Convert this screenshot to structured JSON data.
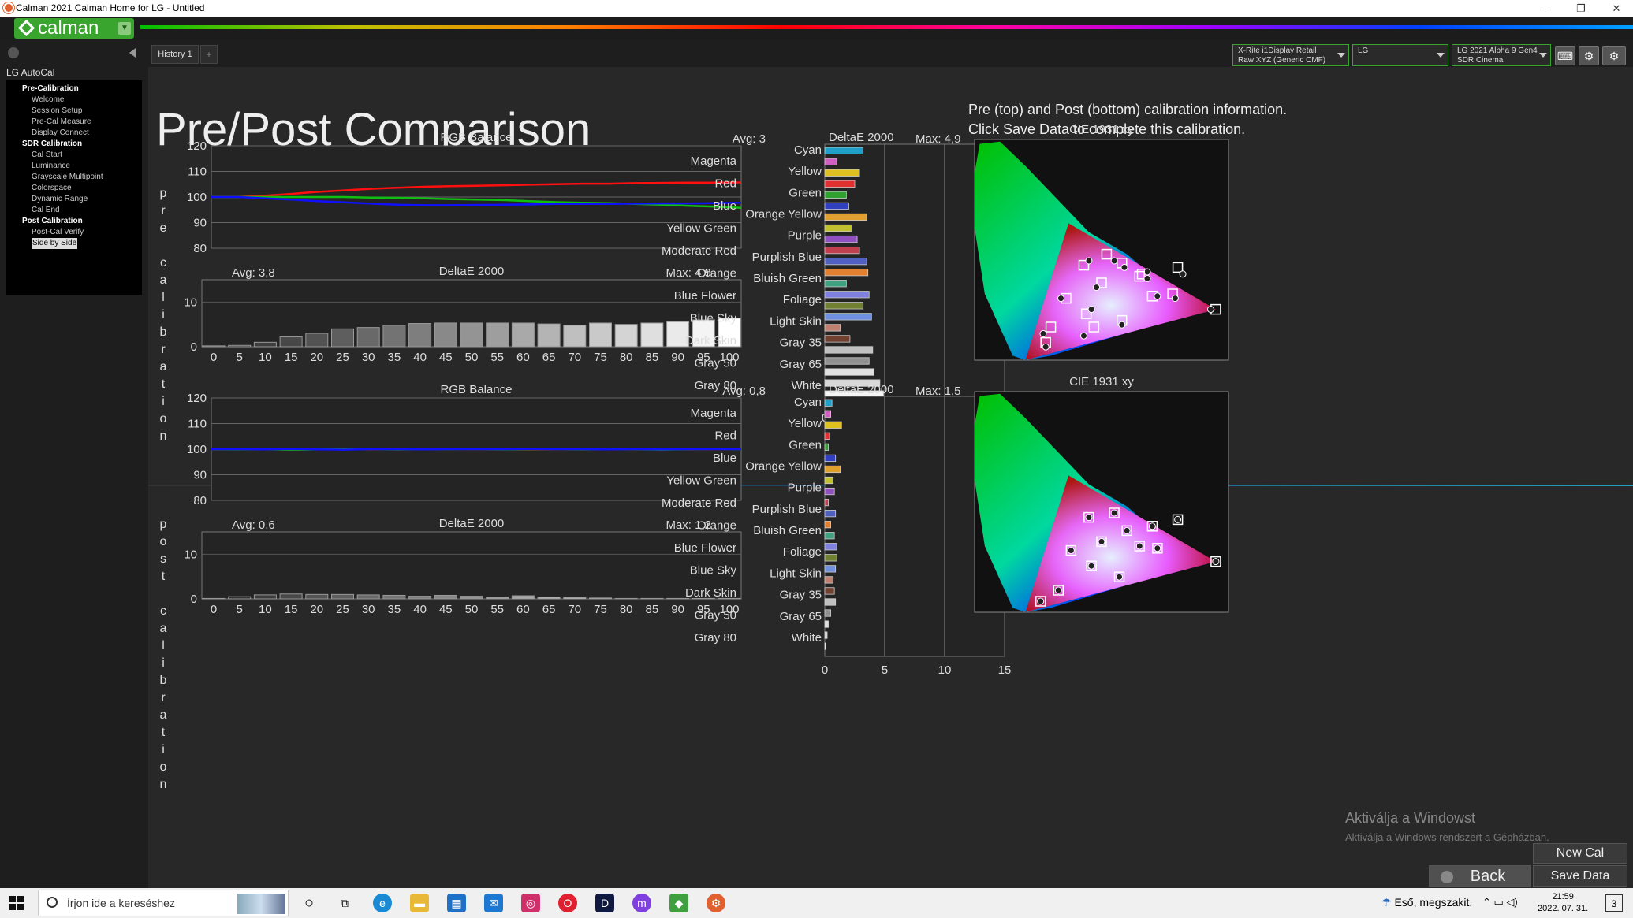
{
  "window": {
    "title": "Calman 2021 Calman Home for LG - Untitled",
    "min": "–",
    "max": "❐",
    "close": "✕"
  },
  "logo": {
    "text": "calman",
    "menu_icon": "chevron-down-icon"
  },
  "sidebar": {
    "title": "LG AutoCal",
    "items": [
      {
        "label": "Pre-Calibration",
        "type": "h"
      },
      {
        "label": "Welcome",
        "type": "i"
      },
      {
        "label": "Session Setup",
        "type": "i"
      },
      {
        "label": "Pre-Cal Measure",
        "type": "i"
      },
      {
        "label": "Display  Connect",
        "type": "i"
      },
      {
        "label": "SDR Calibration",
        "type": "h"
      },
      {
        "label": "Cal Start",
        "type": "i"
      },
      {
        "label": "Luminance",
        "type": "i"
      },
      {
        "label": "Grayscale Multipoint",
        "type": "i"
      },
      {
        "label": "Colorspace",
        "type": "i"
      },
      {
        "label": "Dynamic Range",
        "type": "i"
      },
      {
        "label": "Cal End",
        "type": "i"
      },
      {
        "label": "Post Calibration",
        "type": "h"
      },
      {
        "label": "Post-Cal Verify",
        "type": "i"
      },
      {
        "label": "Side by Side",
        "type": "sel"
      }
    ]
  },
  "history": {
    "tab": "History 1",
    "add": "+"
  },
  "devices": [
    {
      "line1": "X-Rite i1Display Retail",
      "line2": "Raw XYZ (Generic CMF)"
    },
    {
      "line1": "LG",
      "line2": ""
    },
    {
      "line1": "LG 2021 Alpha 9 Gen4",
      "line2": "SDR Cinema"
    }
  ],
  "page": {
    "title": "Pre/Post Comparison",
    "info_line1": "Pre (top) and Post (bottom) calibration information.",
    "info_line2": "Click Save Data to complete this calibration.",
    "pre_label": "pre calibration",
    "post_label": "post calibration"
  },
  "buttons": {
    "new_cal": "New Cal",
    "back": "Back",
    "save_data": "Save Data"
  },
  "watermark": {
    "line1": "Aktiválja a Windowst",
    "line2": "Aktiválja a Windows rendszert a Gépházban."
  },
  "taskbar": {
    "search_placeholder": "Írjon ide a kereséshez",
    "weather": "Eső, megszakit.",
    "time": "21:59",
    "date": "2022. 07. 31.",
    "notif": "3"
  },
  "chart_data": [
    {
      "type": "line",
      "title": "RGB Balance",
      "section": "pre",
      "ylim": [
        80,
        120
      ],
      "yticks": [
        80,
        90,
        100,
        110,
        120
      ],
      "x": [
        0,
        5,
        10,
        15,
        20,
        25,
        30,
        35,
        40,
        45,
        50,
        55,
        60,
        65,
        70,
        75,
        80,
        85,
        90,
        95,
        100
      ],
      "series": [
        {
          "color": "#ff1010",
          "values": [
            100,
            100,
            100.5,
            101.2,
            102,
            102.6,
            103.2,
            103.6,
            104,
            104.2,
            104.4,
            104.6,
            104.8,
            105,
            105.2,
            105.2,
            105.4,
            105.5,
            105.6,
            105.6,
            105.7
          ]
        },
        {
          "color": "#10c010",
          "values": [
            100,
            100,
            100,
            100,
            100,
            100,
            99.8,
            99.7,
            99.5,
            99.2,
            99,
            98.8,
            98.4,
            98,
            97.8,
            97.6,
            97.3,
            97,
            96.6,
            96.2,
            95.8
          ]
        },
        {
          "color": "#1010ff",
          "values": [
            100,
            100,
            99.5,
            99,
            98.4,
            97.9,
            97.4,
            97,
            96.8,
            96.8,
            96.9,
            97,
            97.1,
            97.3,
            97.3,
            97.3,
            97.4,
            97.5,
            97.5,
            97.6,
            97.8
          ]
        }
      ]
    },
    {
      "type": "bar",
      "title": "DeltaE 2000",
      "section": "pre",
      "avg": "Avg: 3,8",
      "max": "Max: 4,9",
      "ylim": [
        0,
        15
      ],
      "yticks": [
        0,
        10
      ],
      "categories": [
        "0",
        "5",
        "10",
        "15",
        "20",
        "25",
        "30",
        "35",
        "40",
        "45",
        "50",
        "55",
        "60",
        "65",
        "70",
        "75",
        "80",
        "85",
        "90",
        "95",
        "100"
      ],
      "values": [
        0.2,
        0.3,
        1.0,
        2.2,
        3.0,
        4.0,
        4.3,
        4.8,
        5.2,
        5.3,
        5.3,
        5.3,
        5.3,
        5.1,
        4.8,
        5.3,
        5.0,
        5.3,
        5.6,
        6.0,
        6.4
      ]
    },
    {
      "type": "bar",
      "title": "DeltaE 2000",
      "section": "pre",
      "orientation": "horizontal",
      "avg": "Avg: 3",
      "max": "Max: 4,9",
      "xlim": [
        0,
        15
      ],
      "xticks": [
        0,
        5,
        10,
        15
      ],
      "left_labels": [
        "Magenta",
        "Red",
        "Blue",
        "Yellow Green",
        "Moderate Red",
        "Orange",
        "Blue Flower",
        "Blue Sky",
        "Dark Skin",
        "Gray 50",
        "Gray 80"
      ],
      "right_labels": [
        "Cyan",
        "Yellow",
        "Green",
        "Orange Yellow",
        "Purple",
        "Purplish Blue",
        "Bluish Green",
        "Foliage",
        "Light Skin",
        "Gray 35",
        "Gray 65",
        "White"
      ],
      "values": [
        3.2,
        1.0,
        2.9,
        2.5,
        1.8,
        2.0,
        3.5,
        2.2,
        2.7,
        2.9,
        3.5,
        3.6,
        1.8,
        3.7,
        3.2,
        3.9,
        1.3,
        2.1,
        4.0,
        3.7,
        4.1,
        4.6,
        4.9
      ],
      "colors": [
        "#20a0c8",
        "#d060c0",
        "#e0c020",
        "#e03030",
        "#30a030",
        "#3040c0",
        "#e0a030",
        "#c0c030",
        "#9050c0",
        "#c04050",
        "#5060c0",
        "#e08030",
        "#40a080",
        "#8080e0",
        "#708030",
        "#7090e0",
        "#c08070",
        "#704030",
        "#c0c0c0",
        "#909090",
        "#e0e0e0",
        "#d8d8d8",
        "#f4f4f4"
      ]
    },
    {
      "type": "scatter",
      "title": "CIE 1931 xy",
      "section": "pre"
    },
    {
      "type": "line",
      "title": "RGB Balance",
      "section": "post",
      "ylim": [
        80,
        120
      ],
      "yticks": [
        80,
        90,
        100,
        110,
        120
      ],
      "x": [
        0,
        5,
        10,
        15,
        20,
        25,
        30,
        35,
        40,
        45,
        50,
        55,
        60,
        65,
        70,
        75,
        80,
        85,
        90,
        95,
        100
      ],
      "series": [
        {
          "color": "#ff1010",
          "values": [
            100,
            100.1,
            100,
            100.2,
            100,
            100.1,
            99.9,
            100.2,
            100,
            100.1,
            100,
            100,
            99.9,
            100,
            100.1,
            100.2,
            100,
            100.1,
            100,
            100,
            100.1
          ]
        },
        {
          "color": "#10c010",
          "values": [
            100,
            99.9,
            100,
            99.8,
            99.9,
            100,
            100.1,
            99.9,
            100,
            100,
            100.1,
            99.9,
            100,
            100.1,
            99.9,
            100,
            100,
            99.8,
            100,
            100.1,
            100
          ]
        },
        {
          "color": "#1010ff",
          "values": [
            100,
            100,
            99.9,
            100.1,
            99.9,
            99.8,
            100,
            100,
            99.9,
            100,
            100,
            100,
            100.1,
            100,
            100,
            99.9,
            100,
            99.9,
            100,
            100,
            100
          ]
        }
      ]
    },
    {
      "type": "bar",
      "title": "DeltaE 2000",
      "section": "post",
      "avg": "Avg: 0,6",
      "max": "Max: 1,2",
      "ylim": [
        0,
        15
      ],
      "yticks": [
        0,
        10
      ],
      "categories": [
        "0",
        "5",
        "10",
        "15",
        "20",
        "25",
        "30",
        "35",
        "40",
        "45",
        "50",
        "55",
        "60",
        "65",
        "70",
        "75",
        "80",
        "85",
        "90",
        "95",
        "100"
      ],
      "values": [
        0.1,
        0.5,
        0.9,
        1.1,
        1.0,
        1.0,
        0.9,
        0.8,
        0.6,
        0.8,
        0.6,
        0.4,
        0.7,
        0.4,
        0.3,
        0.2,
        0.1,
        0.1,
        0.1,
        0.1,
        0.1
      ]
    },
    {
      "type": "bar",
      "title": "DeltaE 2000",
      "section": "post",
      "orientation": "horizontal",
      "avg": "Avg: 0,8",
      "max": "Max: 1,5",
      "xlim": [
        0,
        15
      ],
      "xticks": [
        0,
        5,
        10,
        15
      ],
      "left_labels": [
        "Magenta",
        "Red",
        "Blue",
        "Yellow Green",
        "Moderate Red",
        "Orange",
        "Blue Flower",
        "Blue Sky",
        "Dark Skin",
        "Gray 50",
        "Gray 80"
      ],
      "right_labels": [
        "Cyan",
        "Yellow",
        "Green",
        "Orange Yellow",
        "Purple",
        "Purplish Blue",
        "Bluish Green",
        "Foliage",
        "Light Skin",
        "Gray 35",
        "Gray 65",
        "White"
      ],
      "values": [
        0.6,
        0.5,
        1.4,
        0.4,
        0.3,
        0.9,
        1.3,
        0.7,
        0.8,
        0.3,
        0.9,
        0.5,
        0.8,
        1.0,
        1.0,
        0.9,
        0.7,
        0.8,
        0.9,
        0.5,
        0.3,
        0.2,
        0.1
      ],
      "colors": [
        "#20a0c8",
        "#d060c0",
        "#e0c020",
        "#e03030",
        "#30a030",
        "#3040c0",
        "#e0a030",
        "#c0c030",
        "#9050c0",
        "#c04050",
        "#5060c0",
        "#e08030",
        "#40a080",
        "#8080e0",
        "#708030",
        "#7090e0",
        "#c08070",
        "#704030",
        "#c0c0c0",
        "#909090",
        "#e0e0e0",
        "#d8d8d8",
        "#f4f4f4"
      ]
    },
    {
      "type": "scatter",
      "title": "CIE 1931 xy",
      "section": "post"
    }
  ]
}
